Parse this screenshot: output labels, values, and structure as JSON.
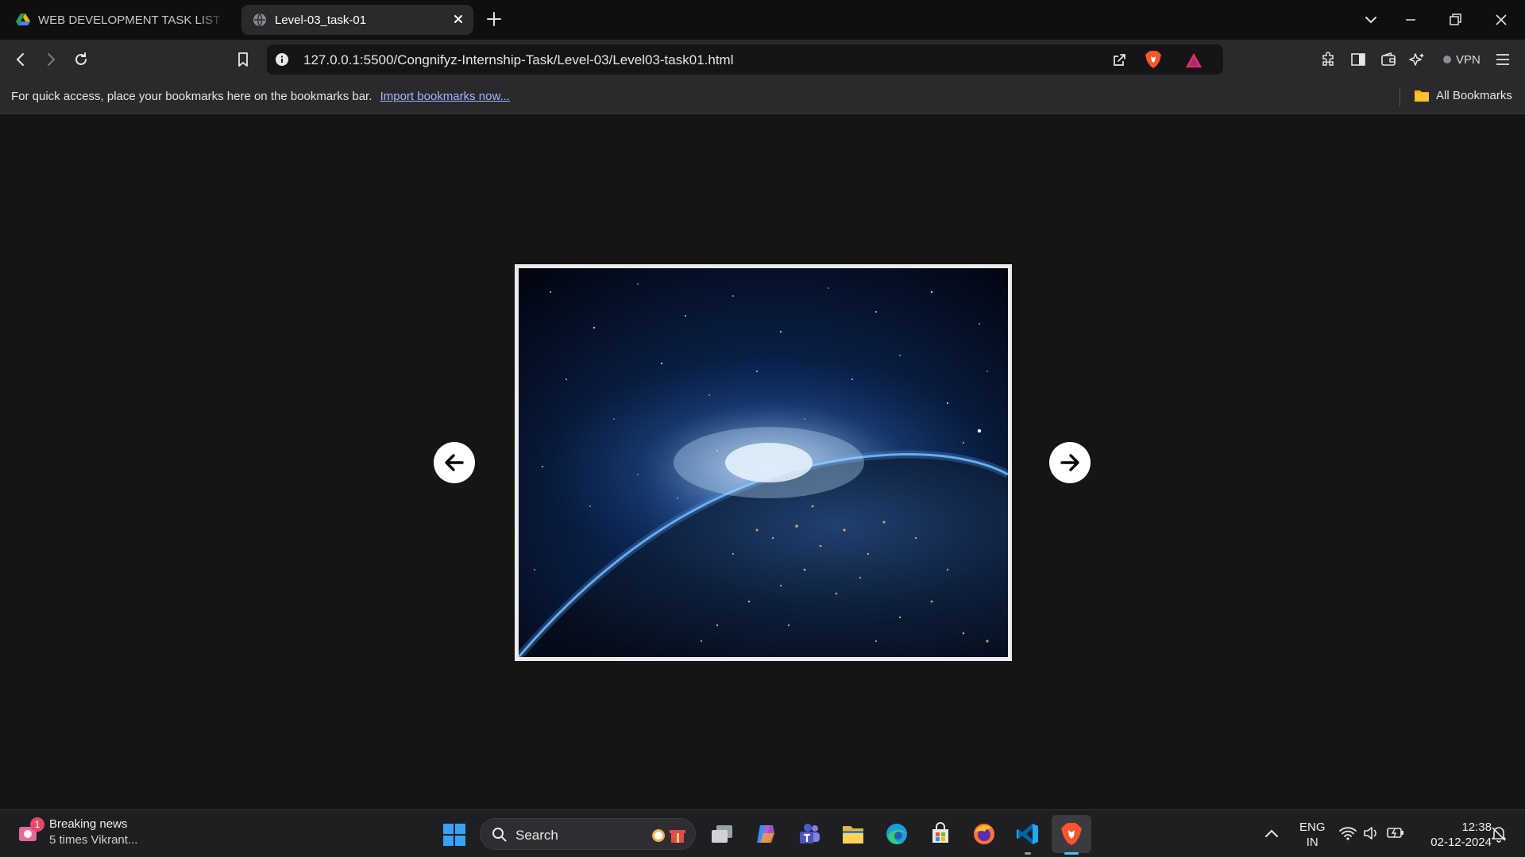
{
  "browser": {
    "tabs": [
      {
        "title": "WEB DEVELOPMENT TASK LIST - Go",
        "active": false,
        "favicon": "google-drive-icon"
      },
      {
        "title": "Level-03_task-01",
        "active": true,
        "favicon": "globe-icon"
      }
    ],
    "url": "127.0.0.1:5500/Congnifyz-Internship-Task/Level-03/Level03-task01.html",
    "vpn_label": "VPN",
    "bookmarks_bar": {
      "hint": "For quick access, place your bookmarks here on the bookmarks bar.",
      "import_link": "Import bookmarks now...",
      "all_bookmarks": "All Bookmarks"
    }
  },
  "page": {
    "slider": {
      "image_alt": "Earth from space at night",
      "prev_icon": "arrow-left-icon",
      "next_icon": "arrow-right-icon"
    }
  },
  "taskbar": {
    "news": {
      "title": "Breaking news",
      "subtitle": "5 times Vikrant...",
      "badge": "1"
    },
    "search_label": "Search",
    "apps": [
      "task-view",
      "copilot",
      "teams",
      "file-explorer",
      "edge",
      "microsoft-store",
      "firefox",
      "vscode",
      "brave"
    ],
    "language": {
      "line1": "ENG",
      "line2": "IN"
    },
    "time": "12:38",
    "date": "02-12-2024"
  },
  "colors": {
    "page_background": "#151516",
    "chrome_background": "#2a2a2d",
    "tabstrip_background": "#0f0f10",
    "slider_border": "#ececec",
    "link_color": "#9fb7ff",
    "taskbar_accent": "#4cc2ff"
  }
}
